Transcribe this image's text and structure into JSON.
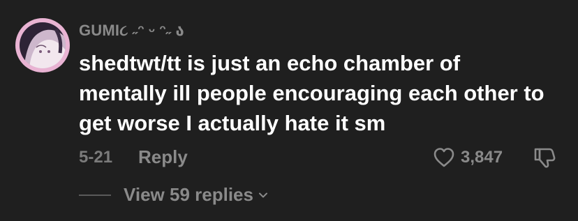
{
  "comment": {
    "username": "GUMI૮ ˶ᵔ ᵕ ᵔ˶ ა",
    "text": "shedtwt/tt is just an echo chamber of mentally ill people encouraging each other to get worse I actually hate it sm",
    "date": "5-21",
    "reply_label": "Reply",
    "like_count": "3,847",
    "view_replies_label": "View 59 replies"
  },
  "icons": {
    "avatar": "avatar",
    "like": "heart-icon",
    "dislike": "thumbs-down-icon",
    "expand": "chevron-down-icon"
  },
  "colors": {
    "background": "#1f1f1f",
    "primary_text": "#ffffff",
    "secondary_text": "#8a8a8a",
    "avatar_ring": "#e9b3d3"
  }
}
